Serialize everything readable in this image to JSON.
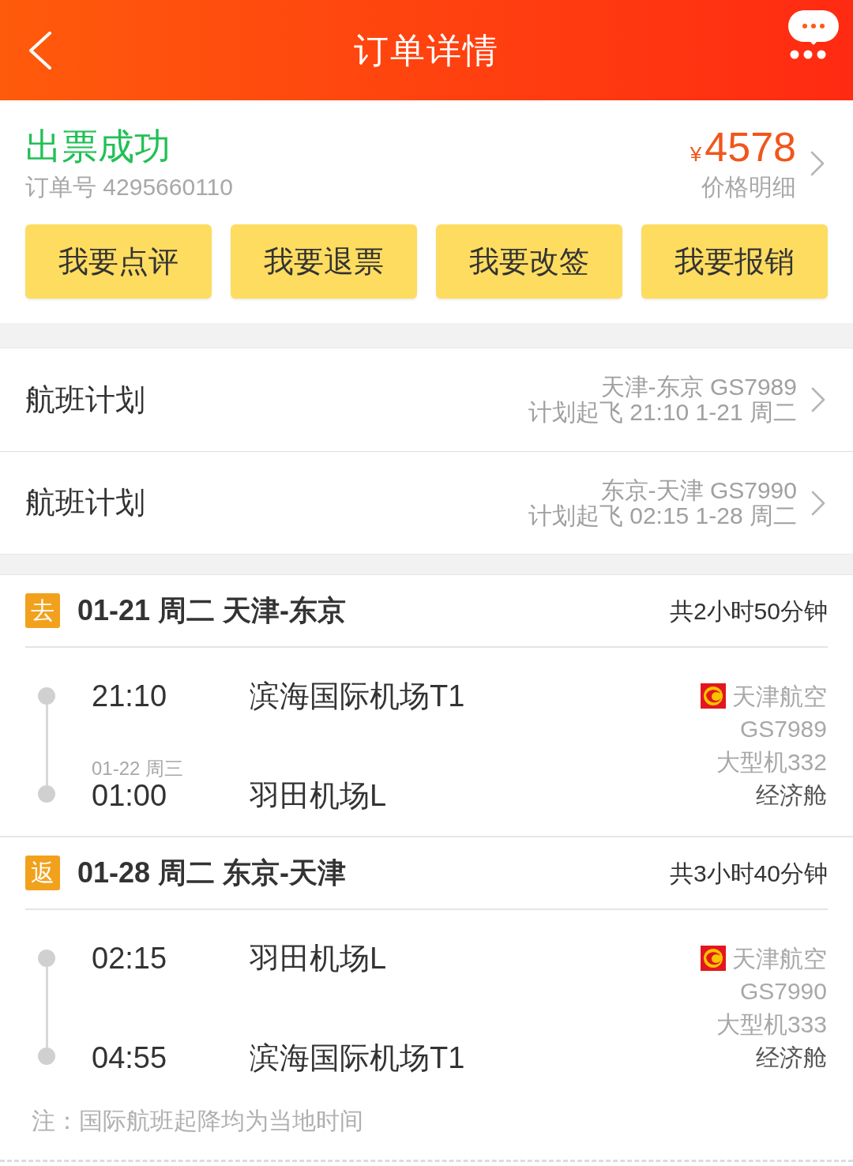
{
  "header": {
    "title": "订单详情"
  },
  "order": {
    "status": "出票成功",
    "order_number": "订单号 4295660110",
    "currency": "¥",
    "price": "4578",
    "price_link": "价格明细"
  },
  "actions": [
    "我要点评",
    "我要退票",
    "我要改签",
    "我要报销"
  ],
  "flight_plans": [
    {
      "label": "航班计划",
      "route": "天津-东京 GS7989",
      "schedule": "计划起飞 21:10 1-21 周二"
    },
    {
      "label": "航班计划",
      "route": "东京-天津 GS7990",
      "schedule": "计划起飞 02:15 1-28 周二"
    }
  ],
  "segments": [
    {
      "badge": "去",
      "title": "01-21 周二 天津-东京",
      "duration": "共2小时50分钟",
      "stops": [
        {
          "time": "21:10",
          "airport": "滨海国际机场T1"
        },
        {
          "date": "01-22 周三",
          "time": "01:00",
          "airport": "羽田机场L"
        }
      ],
      "airline": "天津航空",
      "flight_no": "GS7989",
      "aircraft": "大型机332",
      "cabin": "经济舱"
    },
    {
      "badge": "返",
      "title": "01-28 周二 东京-天津",
      "duration": "共3小时40分钟",
      "stops": [
        {
          "time": "02:15",
          "airport": "羽田机场L"
        },
        {
          "time": "04:55",
          "airport": "滨海国际机场T1"
        }
      ],
      "airline": "天津航空",
      "flight_no": "GS7990",
      "aircraft": "大型机333",
      "cabin": "经济舱"
    }
  ],
  "note": "注：国际航班起降均为当地时间"
}
